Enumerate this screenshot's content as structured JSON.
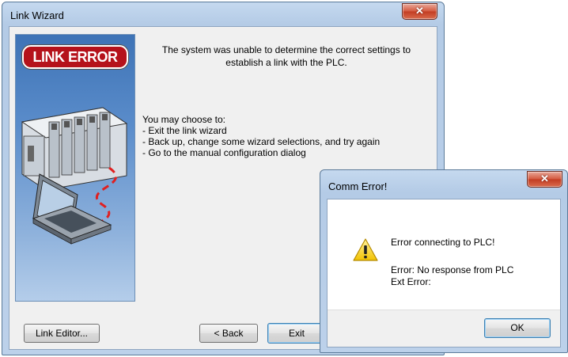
{
  "wizard": {
    "title": "Link Wizard",
    "badge": "LINK ERROR",
    "message": "The system was unable to determine the correct settings to establish a link with the PLC.",
    "choose_intro": "You may choose to:",
    "options": [
      "- Exit the link wizard",
      "- Back up, change some wizard selections, and try again",
      "- Go to the manual configuration dialog"
    ],
    "buttons": {
      "link_editor": "Link Editor...",
      "back": "< Back",
      "exit": "Exit"
    }
  },
  "comm_error": {
    "title": "Comm Error!",
    "heading": "Error connecting to PLC!",
    "error": "Error: No response from PLC",
    "ext_error": "Ext Error:",
    "ok": "OK"
  },
  "icons": {
    "close": "close-icon",
    "warning": "warning-icon"
  },
  "colors": {
    "badge_red": "#b5121b",
    "close_red": "#c23c22",
    "panel_blue": "#3e73b6",
    "cable_red": "#e02020"
  }
}
